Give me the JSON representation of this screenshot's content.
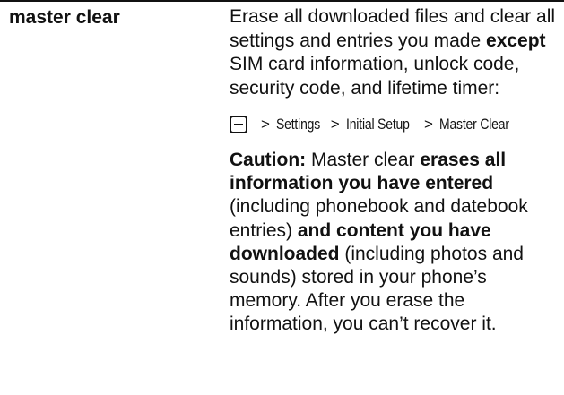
{
  "entry": {
    "term": "master clear",
    "description": {
      "part1": "Erase all downloaded files and clear all settings and entries you made ",
      "bold1": "except",
      "part2": " SIM card information, unlock code, security code, and lifetime timer:"
    },
    "menu_path": {
      "icon": "menu-key-icon",
      "separator": ">",
      "items": [
        "Settings",
        "Initial Setup",
        "Master Clear"
      ]
    },
    "caution": {
      "label": "Caution:",
      "part1": " Master clear ",
      "bold1": "erases all information you have entered",
      "part2": " (including phonebook and datebook entries) ",
      "bold2": "and content you have downloaded",
      "part3": " (including photos and sounds) stored in your phone’s memory. After you erase the information, you can’t recover it."
    }
  }
}
